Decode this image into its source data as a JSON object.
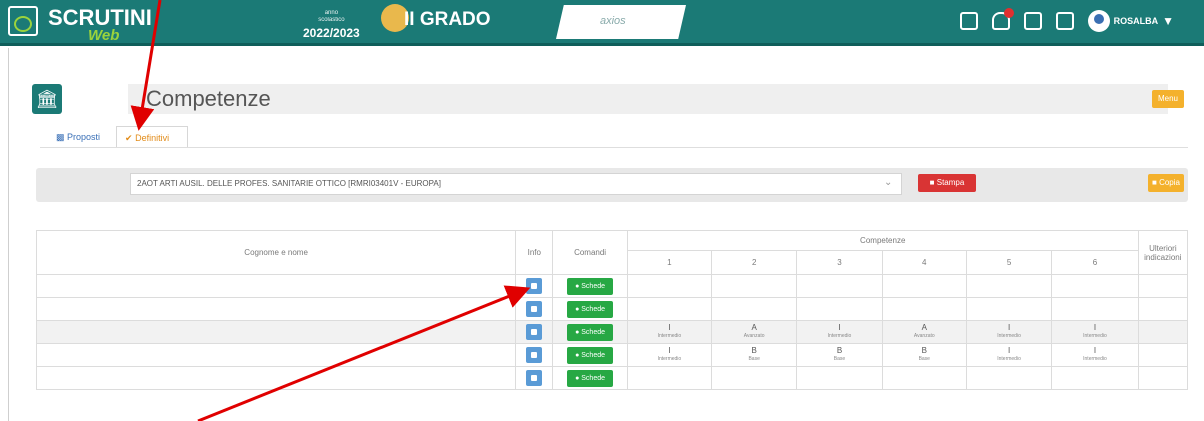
{
  "header": {
    "brand": "SCRUTINI",
    "brand_sub": "Web",
    "year_small_1": "anno",
    "year_small_2": "scolastico",
    "year": "2022/2023",
    "grado": "II GRADO",
    "center_label": "axios",
    "username": "ROSALBA"
  },
  "page": {
    "title": "Competenze",
    "menu_label": "Menu"
  },
  "tabs": [
    {
      "label": "Proposti"
    },
    {
      "label": "Definitivi"
    }
  ],
  "filter": {
    "class_value": "2AOT ARTI AUSIL. DELLE PROFES. SANITARIE OTTICO [RMRI03401V - EUROPA]",
    "stampa_label": "Stampa",
    "copia_label": "Copia"
  },
  "table": {
    "header_name": "Cognome e nome",
    "header_info": "Info",
    "header_comandi": "Comandi",
    "header_competenze": "Competenze",
    "header_ulteriori": "Ulteriori indicazioni",
    "competence_numbers": [
      "1",
      "2",
      "3",
      "4",
      "5",
      "6"
    ],
    "button_label": "Schede",
    "rows": [
      {
        "values": [
          null,
          null,
          null,
          null,
          null,
          null
        ]
      },
      {
        "values": [
          null,
          null,
          null,
          null,
          null,
          null
        ]
      },
      {
        "values": [
          [
            "I",
            "Intermedio"
          ],
          [
            "A",
            "Avanzato"
          ],
          [
            "I",
            "Intermedio"
          ],
          [
            "A",
            "Avanzato"
          ],
          [
            "I",
            "Intermedio"
          ],
          [
            "I",
            "Intermedio"
          ]
        ]
      },
      {
        "values": [
          [
            "I",
            "Intermedio"
          ],
          [
            "B",
            "Base"
          ],
          [
            "B",
            "Base"
          ],
          [
            "B",
            "Base"
          ],
          [
            "I",
            "Intermedio"
          ],
          [
            "I",
            "Intermedio"
          ]
        ]
      },
      {
        "values": [
          null,
          null,
          null,
          null,
          null,
          null
        ]
      }
    ]
  },
  "colors": {
    "topbar": "#1b7a76",
    "accent_green": "#9bd33c",
    "schede_button": "#27a844",
    "stampa_button": "#d93434",
    "yellow_button": "#f4b12c",
    "arrow": "#e00000"
  }
}
